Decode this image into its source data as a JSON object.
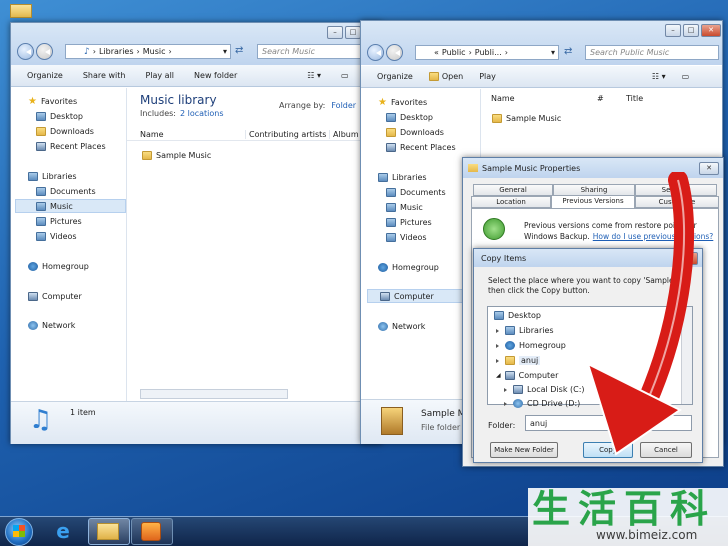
{
  "desktop": {
    "accent": "#1f62b0"
  },
  "left_window": {
    "address": {
      "crumbs": [
        "Libraries",
        "Music"
      ]
    },
    "search_placeholder": "Search Music",
    "toolbar": {
      "organize": "Organize",
      "share_with": "Share with",
      "play_all": "Play all",
      "new_folder": "New folder"
    },
    "nav": {
      "favorites": "Favorites",
      "desktop": "Desktop",
      "downloads": "Downloads",
      "recent_places": "Recent Places",
      "libraries": "Libraries",
      "documents": "Documents",
      "music": "Music",
      "pictures": "Pictures",
      "videos": "Videos",
      "homegroup": "Homegroup",
      "computer": "Computer",
      "network": "Network"
    },
    "library": {
      "title": "Music library",
      "includes_label": "Includes:",
      "includes_link": "2 locations",
      "arrange_label": "Arrange by:",
      "arrange_value": "Folder"
    },
    "columns": [
      "Name",
      "Contributing artists",
      "Album"
    ],
    "items": [
      "Sample Music"
    ],
    "status": "1 item"
  },
  "right_window": {
    "address": {
      "crumbs": [
        "«",
        "Public",
        "Publi..."
      ]
    },
    "search_placeholder": "Search Public Music",
    "toolbar": {
      "organize": "Organize",
      "open": "Open",
      "play": "Play"
    },
    "nav": {
      "favorites": "Favorites",
      "desktop": "Desktop",
      "downloads": "Downloads",
      "recent_places": "Recent Places",
      "libraries": "Libraries",
      "documents": "Documents",
      "music": "Music",
      "pictures": "Pictures",
      "videos": "Videos",
      "homegroup": "Homegroup",
      "computer": "Computer",
      "network": "Network"
    },
    "columns": [
      "Name",
      "#",
      "Title"
    ],
    "items": [
      "Sample Music"
    ],
    "details": {
      "name": "Sample M",
      "type": "File folder"
    }
  },
  "properties_dialog": {
    "title": "Sample Music Properties",
    "tabs_row1": [
      "General",
      "Sharing",
      "Security"
    ],
    "tabs_row2": [
      "Location",
      "Previous Versions",
      "Customize"
    ],
    "info_text_1": "Previous versions come from restore points or",
    "info_text_2": "Windows Backup.",
    "info_link": "How do I use previous versions?"
  },
  "copy_dialog": {
    "title": "Copy Items",
    "instruction_1": "Select the place where you want to copy 'Sample M",
    "instruction_2": "then click the Copy button.",
    "tree": [
      "Desktop",
      "Libraries",
      "Homegroup",
      "anuj",
      "Computer",
      "Local Disk (C:)",
      "CD Drive (D:)"
    ],
    "folder_label": "Folder:",
    "folder_value": "anuj",
    "make_new_folder": "Make New Folder",
    "copy": "Copy",
    "cancel": "Cancel"
  },
  "watermark": {
    "chars": "生活百科",
    "url": "www.bimeiz.com"
  }
}
